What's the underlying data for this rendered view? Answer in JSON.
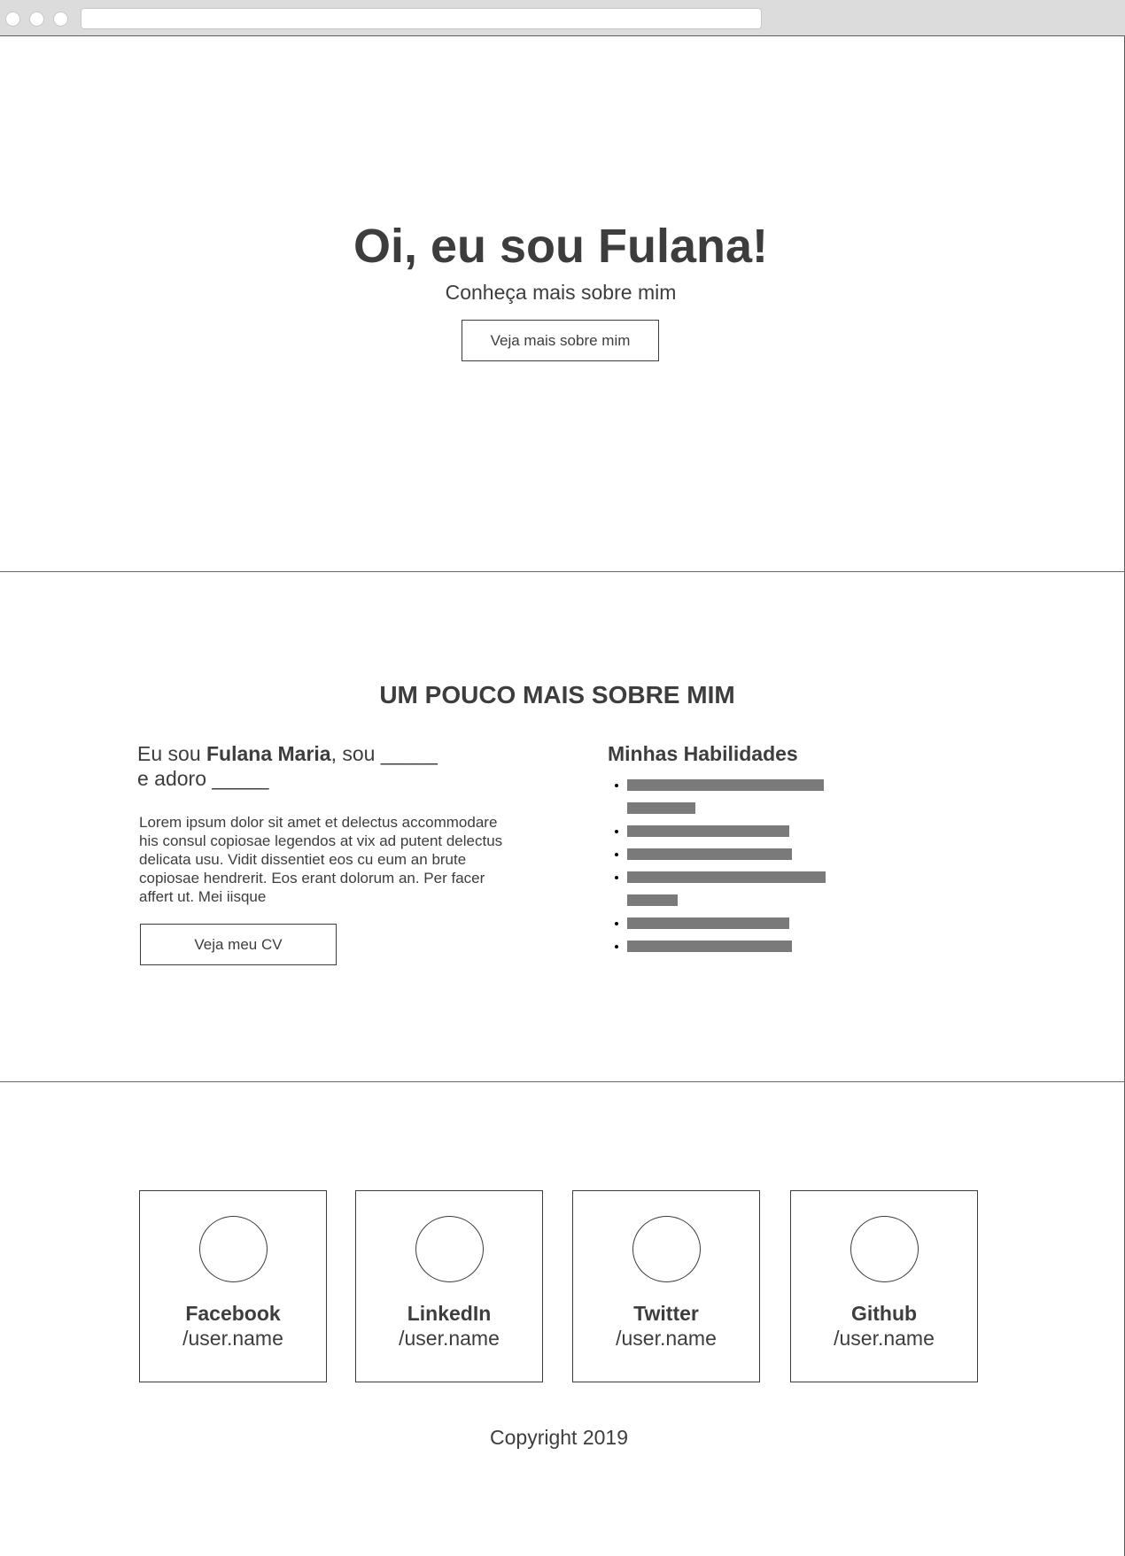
{
  "hero": {
    "title": "Oi, eu sou Fulana!",
    "subtitle": "Conheça mais sobre mim",
    "button_label": "Veja mais sobre mim"
  },
  "about": {
    "heading": "UM POUCO MAIS SOBRE MIM",
    "intro_prefix": "Eu sou ",
    "intro_name": "Fulana Maria",
    "intro_middle": ", sou _____",
    "intro_suffix": "e adoro _____",
    "paragraph": "Lorem ipsum dolor sit amet et delectus accommodare his consul copiosae legendos at vix ad putent delectus delicata usu. Vidit dissentiet eos cu eum an brute copiosae hendrerit. Eos erant dolorum an. Per facer affert ut. Mei iisque",
    "cv_button_label": "Veja meu CV"
  },
  "skills": {
    "heading": "Minhas Habilidades",
    "items": [
      {
        "lines": [
          0.86,
          0.3
        ]
      },
      {
        "lines": [
          0.71
        ]
      },
      {
        "lines": [
          0.72
        ]
      },
      {
        "lines": [
          0.87,
          0.22
        ]
      },
      {
        "lines": [
          0.71
        ]
      },
      {
        "lines": [
          0.72
        ]
      }
    ]
  },
  "social": [
    {
      "network": "Facebook",
      "handle": "/user.name"
    },
    {
      "network": "LinkedIn",
      "handle": "/user.name"
    },
    {
      "network": "Twitter",
      "handle": "/user.name"
    },
    {
      "network": "Github",
      "handle": "/user.name"
    }
  ],
  "footer": {
    "copyright": "Copyright 2019"
  },
  "colors": {
    "text": "#3d3d3d",
    "placeholder_bar": "#7a7a7a",
    "chrome": "#dcdcdc"
  }
}
